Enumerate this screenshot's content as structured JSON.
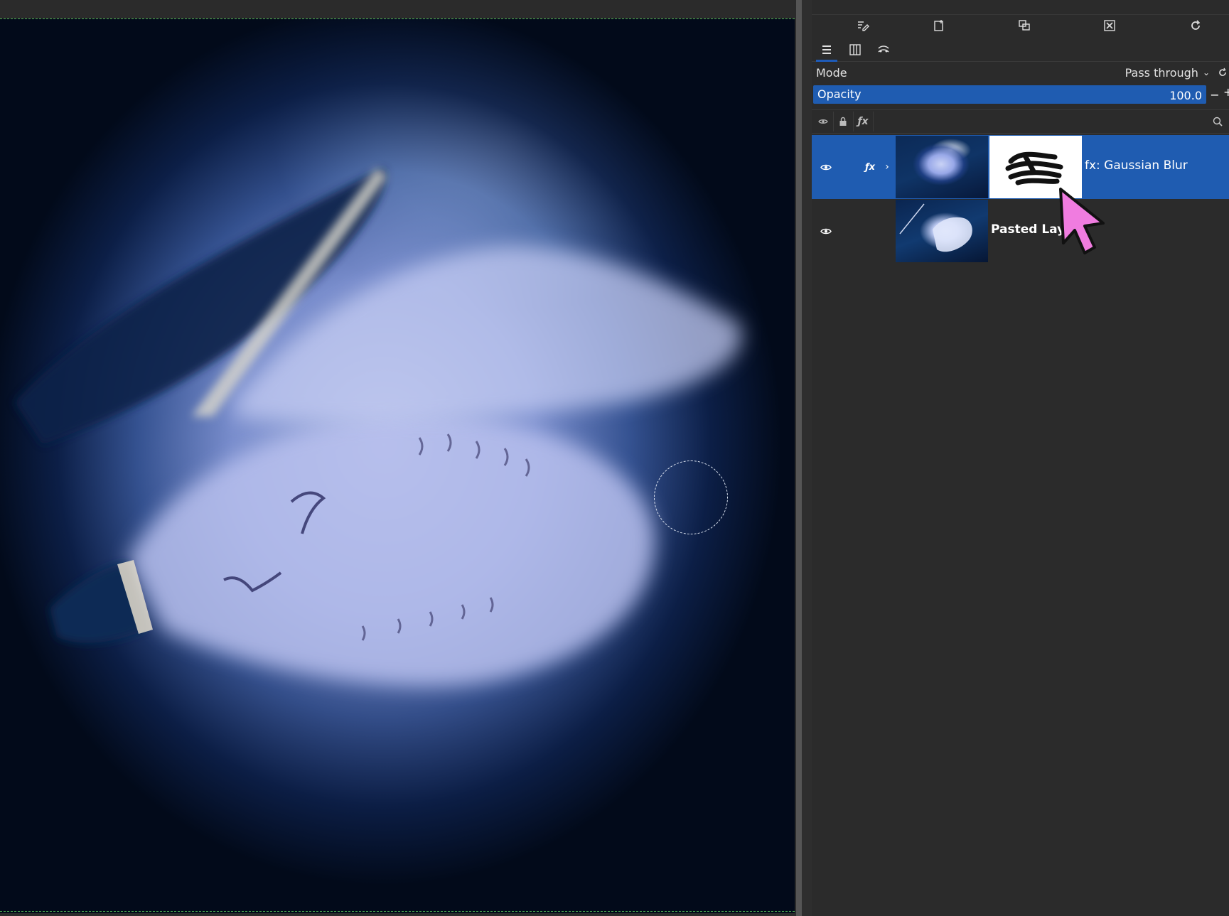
{
  "canvas": {
    "selection_marquee": "dashed-green",
    "brush_outline": "dashed-circle"
  },
  "toolbar": {
    "buttons": [
      {
        "name": "edit-layer-attributes-icon"
      },
      {
        "name": "new-layer-icon"
      },
      {
        "name": "duplicate-layer-icon"
      },
      {
        "name": "delete-layer-icon"
      },
      {
        "name": "refresh-icon"
      }
    ]
  },
  "tabs": [
    {
      "name": "layers-tab-icon",
      "active": true
    },
    {
      "name": "channels-tab-icon",
      "active": false
    },
    {
      "name": "paths-tab-icon",
      "active": false
    }
  ],
  "mode": {
    "label": "Mode",
    "value": "Pass through"
  },
  "opacity": {
    "label": "Opacity",
    "value": "100.0",
    "fraction": 1.0,
    "minus": "−",
    "plus": "+"
  },
  "filter_toggles": [
    "eye-icon",
    "lock-icon",
    "fx-icon"
  ],
  "layers": [
    {
      "name": "fx: Gaussian Blur",
      "selected": true,
      "visible": true,
      "has_fx": true,
      "fx_label": "ƒx",
      "expandable": true,
      "has_mask": true
    },
    {
      "name": "Pasted Laye",
      "selected": false,
      "visible": true,
      "has_fx": false,
      "expandable": false,
      "has_mask": false
    }
  ],
  "colors": {
    "accent": "#1f5cb1",
    "pointer": "#f07ce0",
    "marquee": "#4caf50"
  }
}
